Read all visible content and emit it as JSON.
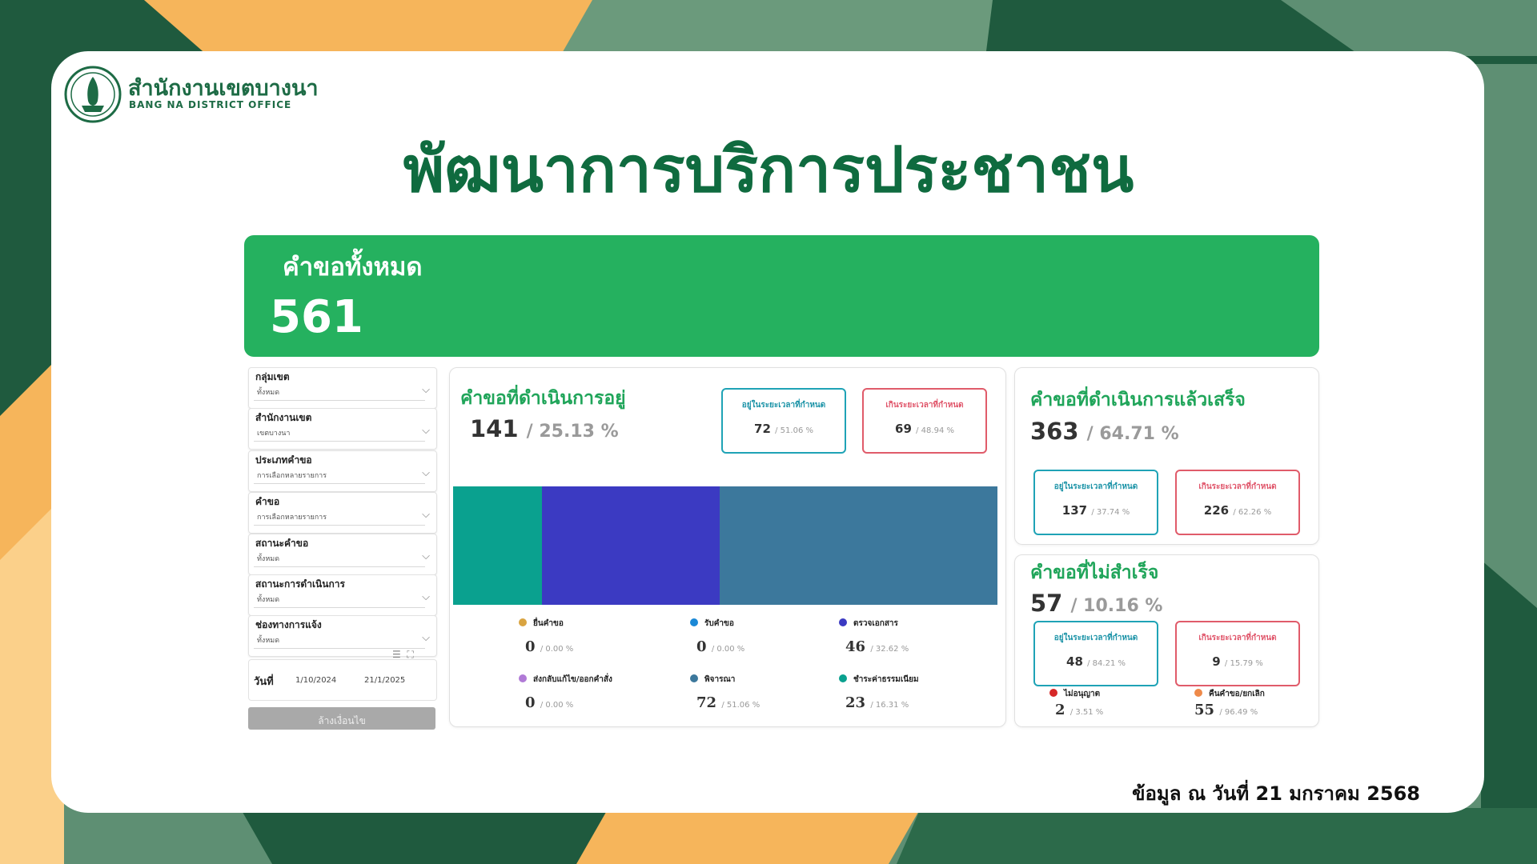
{
  "brand": {
    "org_th": "สำนักงานเขตบางนา",
    "org_en": "BANG NA DISTRICT OFFICE",
    "logo_icon": "bangkok-seal-icon"
  },
  "page_title": "พัฒนาการบริการประชาชน",
  "total": {
    "label": "คำขอทั้งหมด",
    "value": "561"
  },
  "filters": [
    {
      "label": "กลุ่มเขต",
      "value": "ทั้งหมด"
    },
    {
      "label": "สำนักงานเขต",
      "value": "เขตบางนา"
    },
    {
      "label": "ประเภทคำขอ",
      "value": "การเลือกหลายรายการ"
    },
    {
      "label": "คำขอ",
      "value": "การเลือกหลายรายการ"
    },
    {
      "label": "สถานะคำขอ",
      "value": "ทั้งหมด"
    },
    {
      "label": "สถานะการดำเนินการ",
      "value": "ทั้งหมด"
    },
    {
      "label": "ช่องทางการแจ้ง",
      "value": "ทั้งหมด"
    }
  ],
  "date_filter": {
    "label": "วันที่",
    "from": "1/10/2024",
    "to": "21/1/2025"
  },
  "clear_label": "ล้างเงื่อนไข",
  "in_progress": {
    "title": "คำขอที่ดำเนินการอยู่",
    "count": "141",
    "pct": "/ 25.13 %",
    "within": {
      "label": "อยู่ในระยะเวลาที่กำหนด",
      "value": "72",
      "pct": "/ 51.06 %"
    },
    "over": {
      "label": "เกินระยะเวลาที่กำหนด",
      "value": "69",
      "pct": "/ 48.94 %"
    },
    "legend": [
      {
        "label": "ยื่นคำขอ",
        "value": "0",
        "pct": "/ 0.00 %",
        "color": "#d9a441"
      },
      {
        "label": "รับคำขอ",
        "value": "0",
        "pct": "/ 0.00 %",
        "color": "#1a88d6"
      },
      {
        "label": "ตรวจเอกสาร",
        "value": "46",
        "pct": "/ 32.62 %",
        "color": "#3b3ac2"
      },
      {
        "label": "ส่งกลับแก้ไข/ออกคำสั่ง",
        "value": "0",
        "pct": "/ 0.00 %",
        "color": "#b07ad6"
      },
      {
        "label": "พิจารณา",
        "value": "72",
        "pct": "/ 51.06 %",
        "color": "#3c789c"
      },
      {
        "label": "ชำระค่าธรรมเนียม",
        "value": "23",
        "pct": "/ 16.31 %",
        "color": "#0aa18f"
      }
    ]
  },
  "completed": {
    "title": "คำขอที่ดำเนินการแล้วเสร็จ",
    "count": "363",
    "pct": "/ 64.71 %",
    "within": {
      "label": "อยู่ในระยะเวลาที่กำหนด",
      "value": "137",
      "pct": "/ 37.74 %"
    },
    "over": {
      "label": "เกินระยะเวลาที่กำหนด",
      "value": "226",
      "pct": "/ 62.26 %"
    }
  },
  "failed": {
    "title": "คำขอที่ไม่สำเร็จ",
    "count": "57",
    "pct": "/ 10.16 %",
    "within": {
      "label": "อยู่ในระยะเวลาที่กำหนด",
      "value": "48",
      "pct": "/ 84.21 %"
    },
    "over": {
      "label": "เกินระยะเวลาที่กำหนด",
      "value": "9",
      "pct": "/ 15.79 %"
    },
    "reasons": [
      {
        "label": "ไม่อนุญาต",
        "value": "2",
        "pct": "/ 3.51 %",
        "color": "#d62828"
      },
      {
        "label": "คืนคำขอ/ยกเลิก",
        "value": "55",
        "pct": "/ 96.49 %",
        "color": "#ee8a4a"
      }
    ]
  },
  "footer_note": "ข้อมูล ณ วันที่ 21 มกราคม 2568"
}
